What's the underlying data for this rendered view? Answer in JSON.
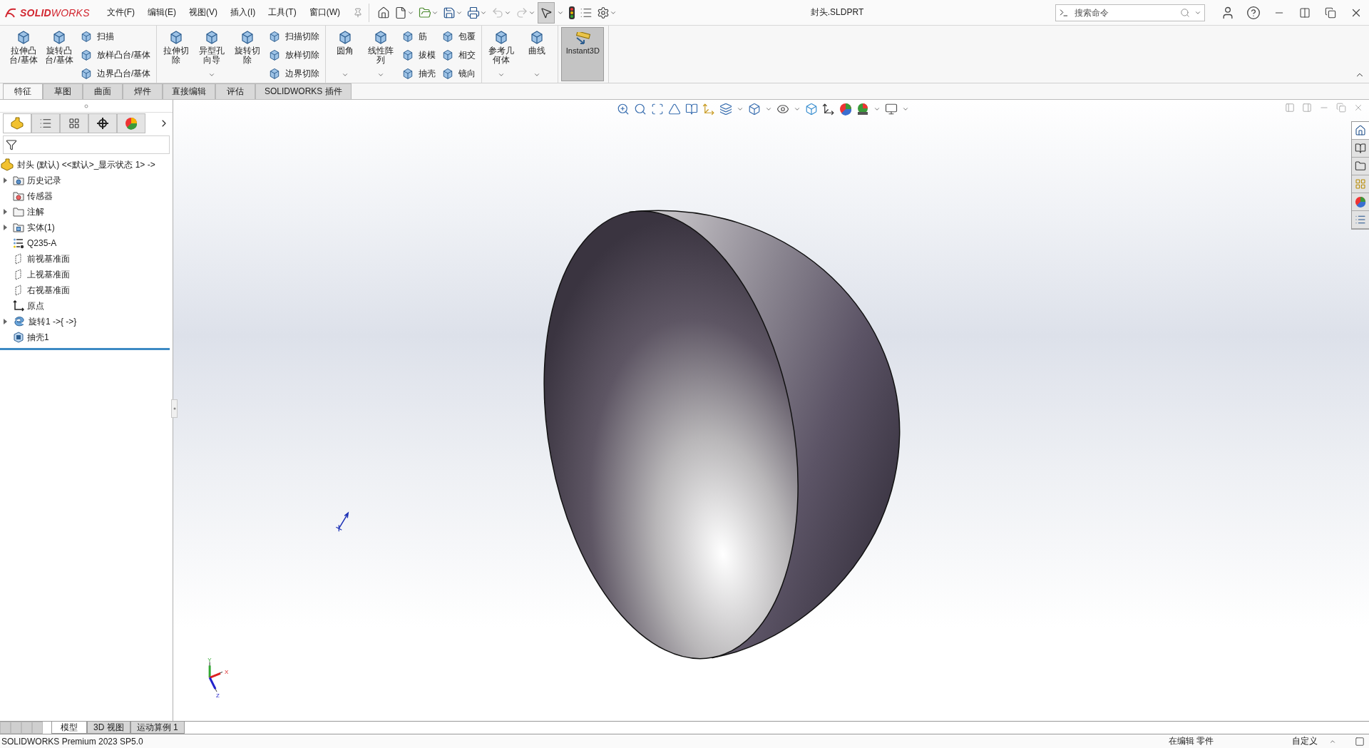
{
  "brand": "**SOLID**WORKS",
  "menu": [
    {
      "label": "文件(F)"
    },
    {
      "label": "编辑(E)"
    },
    {
      "label": "视图(V)"
    },
    {
      "label": "插入(I)"
    },
    {
      "label": "工具(T)"
    },
    {
      "label": "窗口(W)"
    }
  ],
  "quick_toolbar": {
    "select_active": true
  },
  "title": "封头.SLDPRT",
  "search": {
    "placeholder": "搜索命令"
  },
  "ribbon": {
    "groups": [
      {
        "items": [
          {
            "kind": "large",
            "label": "拉伸凸台/基体",
            "dropdown": false
          },
          {
            "kind": "large",
            "label": "旋转凸台/基体",
            "dropdown": false
          },
          {
            "kind": "stack",
            "items": [
              {
                "label": "扫描"
              },
              {
                "label": "放样凸台/基体"
              },
              {
                "label": "边界凸台/基体"
              }
            ]
          }
        ]
      },
      {
        "items": [
          {
            "kind": "large",
            "label": "拉伸切除",
            "dropdown": false
          },
          {
            "kind": "large",
            "label": "异型孔向导",
            "dropdown": true
          },
          {
            "kind": "large",
            "label": "旋转切除",
            "dropdown": false
          },
          {
            "kind": "stack",
            "items": [
              {
                "label": "扫描切除"
              },
              {
                "label": "放样切除"
              },
              {
                "label": "边界切除"
              }
            ]
          }
        ]
      },
      {
        "items": [
          {
            "kind": "large",
            "label": "圆角",
            "dropdown": true
          },
          {
            "kind": "large",
            "label": "线性阵列",
            "dropdown": true
          },
          {
            "kind": "stack",
            "items": [
              {
                "label": "筋"
              },
              {
                "label": "拔模"
              },
              {
                "label": "抽壳"
              }
            ]
          },
          {
            "kind": "stack",
            "items": [
              {
                "label": "包覆"
              },
              {
                "label": "相交"
              },
              {
                "label": "镜向"
              }
            ]
          }
        ]
      },
      {
        "items": [
          {
            "kind": "large",
            "label": "参考几何体",
            "dropdown": true
          },
          {
            "kind": "large",
            "label": "曲线",
            "dropdown": true
          }
        ]
      },
      {
        "items": [
          {
            "kind": "toggle",
            "label": "Instant3D",
            "selected": true
          }
        ]
      }
    ]
  },
  "command_tabs": [
    {
      "label": "特征",
      "selected": true
    },
    {
      "label": "草图",
      "selected": false
    },
    {
      "label": "曲面",
      "selected": false
    },
    {
      "label": "焊件",
      "selected": false
    },
    {
      "label": "直接编辑",
      "selected": false
    },
    {
      "label": "评估",
      "selected": false
    },
    {
      "label": "SOLIDWORKS 插件",
      "selected": false
    }
  ],
  "tree": {
    "tabs": [
      {
        "kind": "features",
        "selected": true
      },
      {
        "kind": "properties",
        "selected": false
      },
      {
        "kind": "configurations",
        "selected": false
      },
      {
        "kind": "dimensions",
        "selected": false
      },
      {
        "kind": "appearance",
        "selected": false
      }
    ],
    "root": {
      "label": "封头 (默认) <<默认>_显示状态 1> ->"
    },
    "items": [
      {
        "kind": "history",
        "label": "历史记录",
        "expanded": false
      },
      {
        "kind": "sensors",
        "label": "传感器"
      },
      {
        "kind": "annotations",
        "label": "注解",
        "expanded": false
      },
      {
        "kind": "bodies",
        "label": "实体(1)",
        "expanded": false
      },
      {
        "kind": "material",
        "label": "Q235-A"
      },
      {
        "kind": "plane",
        "label": "前视基准面"
      },
      {
        "kind": "plane",
        "label": "上视基准面"
      },
      {
        "kind": "plane",
        "label": "右视基准面"
      },
      {
        "kind": "origin",
        "label": "原点"
      },
      {
        "kind": "revolve",
        "label": "旋转1 ->{ ->}",
        "expanded": false
      },
      {
        "kind": "shell",
        "label": "抽壳1"
      }
    ]
  },
  "triad": {
    "x": "X",
    "y": "Y",
    "z": "Z"
  },
  "document_tabs": [
    {
      "label": "模型",
      "selected": true
    },
    {
      "label": "3D 视图",
      "selected": false
    },
    {
      "label": "运动算例 1",
      "selected": false
    }
  ],
  "status_bar": {
    "version": "SOLIDWORKS Premium 2023 SP5.0",
    "mode": "在编辑 零件",
    "units": "自定义"
  }
}
